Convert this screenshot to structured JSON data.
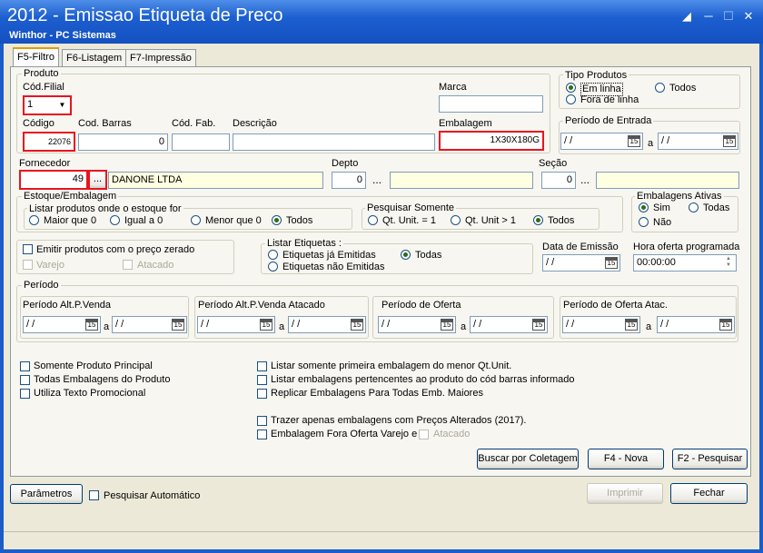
{
  "window": {
    "title": "2012 - Emissao Etiqueta de Preco",
    "subtitle": "Winthor - PC Sistemas"
  },
  "tabs": [
    "F5-Filtro",
    "F6-Listagem",
    "F7-Impressão"
  ],
  "produto": {
    "group_label": "Produto",
    "cod_filial_label": "Cód.Filial",
    "cod_filial_value": "1",
    "marca_label": "Marca",
    "marca_value": "",
    "codigo_label": "Código",
    "codigo_value": "22076",
    "cod_barras_label": "Cod. Barras",
    "cod_barras_value": "0",
    "cod_fab_label": "Cód. Fab.",
    "cod_fab_value": "",
    "descricao_label": "Descrição",
    "descricao_value": "",
    "embalagem_label": "Embalagem",
    "embalagem_value": "1X30X180G"
  },
  "tipo_produtos": {
    "label": "Tipo Produtos",
    "em_linha": "Em linha",
    "fora_de_linha": "Fora de linha",
    "todos": "Todos"
  },
  "periodo_entrada": {
    "label": "Período de Entrada",
    "start": "/ /",
    "sep": "a",
    "end": "/ /"
  },
  "fornecedor": {
    "label": "Fornecedor",
    "code": "49",
    "name": "DANONE LTDA",
    "dots": "..."
  },
  "depto": {
    "label": "Depto",
    "code": "0",
    "dots": "..."
  },
  "secao": {
    "label": "Seção",
    "code": "0",
    "dots": "..."
  },
  "estoque": {
    "group_label": "Estoque/Embalagem",
    "listar_label": "Listar produtos onde o estoque for",
    "options": [
      "Maior que 0",
      "Igual a 0",
      "Menor que 0",
      "Todos"
    ],
    "pesquisar_label": "Pesquisar Somente",
    "pesquisar_options": [
      "Qt. Unit. = 1",
      "Qt. Unit  > 1",
      "Todos"
    ]
  },
  "embalagens_ativas": {
    "label": "Embalagens Ativas",
    "sim": "Sim",
    "todas": "Todas",
    "nao": "Não"
  },
  "emitir": {
    "label": "Emitir produtos com o preço zerado",
    "varejo": "Varejo",
    "atacado": "Atacado"
  },
  "listar_etiquetas": {
    "label": "Listar Etiquetas :",
    "ja_emitidas": "Etiquetas já Emitidas",
    "nao_emitidas": "Etiquetas não Emitidas",
    "todas": "Todas"
  },
  "data_emissao": {
    "label": "Data de Emissão",
    "value": "/ /"
  },
  "hora_oferta": {
    "label": "Hora oferta programada",
    "value": "00:00:00"
  },
  "periodo": {
    "group_label": "Período",
    "sections": [
      {
        "label": "Período Alt.P.Venda",
        "start": "/ /",
        "sep": "a",
        "end": "/ /"
      },
      {
        "label": "Período Alt.P.Venda Atacado",
        "start": "/ /",
        "sep": "a",
        "end": "/ /"
      },
      {
        "label": "Período de Oferta",
        "start": "/ /",
        "sep": "a",
        "end": "/ /"
      },
      {
        "label": "Período de Oferta Atac.",
        "start": "/ /",
        "sep": "a",
        "end": "/ /"
      }
    ]
  },
  "checks_left": [
    "Somente Produto Principal",
    "Todas Embalagens do Produto",
    "Utiliza Texto Promocional"
  ],
  "checks_right": [
    "Listar somente primeira embalagem do menor Qt.Unit.",
    "Listar embalagens pertencentes ao produto do cód barras informado",
    "Replicar Embalagens Para Todas Emb. Maiores"
  ],
  "checks_bottom": [
    "Trazer apenas embalagens com Preços Alterados (2017).",
    "Embalagem Fora Oferta Varejo e",
    "Atacado"
  ],
  "buttons": {
    "buscar": "Buscar por Coletagem",
    "nova": "F4 - Nova",
    "pesquisar": "F2 - Pesquisar",
    "parametros": "Parâmetros",
    "imprimir": "Imprimir",
    "fechar": "Fechar"
  },
  "pesquisar_automatico": "Pesquisar Automático",
  "cal_icon": "15"
}
